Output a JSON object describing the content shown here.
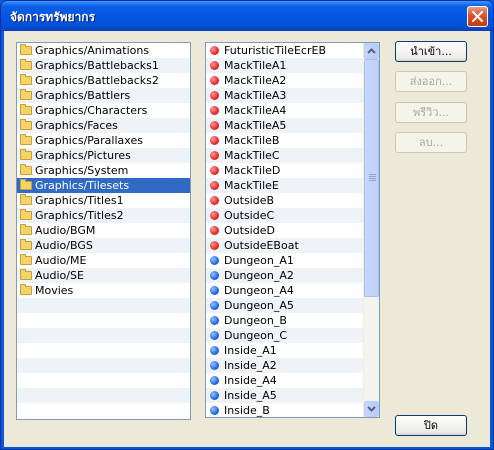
{
  "window": {
    "title": "จัดการทรัพยากร"
  },
  "folders": [
    "Graphics/Animations",
    "Graphics/Battlebacks1",
    "Graphics/Battlebacks2",
    "Graphics/Battlers",
    "Graphics/Characters",
    "Graphics/Faces",
    "Graphics/Parallaxes",
    "Graphics/Pictures",
    "Graphics/System",
    "Graphics/Tilesets",
    "Graphics/Titles1",
    "Graphics/Titles2",
    "Audio/BGM",
    "Audio/BGS",
    "Audio/ME",
    "Audio/SE",
    "Movies"
  ],
  "selected_folder": "Graphics/Tilesets",
  "files": [
    {
      "name": "FuturisticTileEcrEB",
      "color": "red"
    },
    {
      "name": "MackTileA1",
      "color": "red"
    },
    {
      "name": "MackTileA2",
      "color": "red"
    },
    {
      "name": "MackTileA3",
      "color": "red"
    },
    {
      "name": "MackTileA4",
      "color": "red"
    },
    {
      "name": "MackTileA5",
      "color": "red"
    },
    {
      "name": "MackTileB",
      "color": "red"
    },
    {
      "name": "MackTileC",
      "color": "red"
    },
    {
      "name": "MackTileD",
      "color": "red"
    },
    {
      "name": "MackTileE",
      "color": "red"
    },
    {
      "name": "OutsideB",
      "color": "red"
    },
    {
      "name": "OutsideC",
      "color": "red"
    },
    {
      "name": "OutsideD",
      "color": "red"
    },
    {
      "name": "OutsideEBoat",
      "color": "red"
    },
    {
      "name": "Dungeon_A1",
      "color": "blue"
    },
    {
      "name": "Dungeon_A2",
      "color": "blue"
    },
    {
      "name": "Dungeon_A4",
      "color": "blue"
    },
    {
      "name": "Dungeon_A5",
      "color": "blue"
    },
    {
      "name": "Dungeon_B",
      "color": "blue"
    },
    {
      "name": "Dungeon_C",
      "color": "blue"
    },
    {
      "name": "Inside_A1",
      "color": "blue"
    },
    {
      "name": "Inside_A2",
      "color": "blue"
    },
    {
      "name": "Inside_A4",
      "color": "blue"
    },
    {
      "name": "Inside_A5",
      "color": "blue"
    },
    {
      "name": "Inside_B",
      "color": "blue"
    }
  ],
  "buttons": {
    "import": "นำเข้า...",
    "export": "ส่งออก...",
    "preview": "พรีวิว...",
    "delete": "ลบ...",
    "close": "ปิด"
  },
  "icons": {
    "folder": "folder-icon",
    "red_dot": "rtp-resource-red-icon",
    "blue_dot": "project-resource-blue-icon",
    "close": "close-icon",
    "scroll_up": "arrow-up-icon",
    "scroll_down": "arrow-down-icon"
  },
  "colors": {
    "selection": "#316ac5",
    "titlebar": "#0555e3",
    "red": "#e8322f",
    "blue": "#2a6ee8"
  }
}
